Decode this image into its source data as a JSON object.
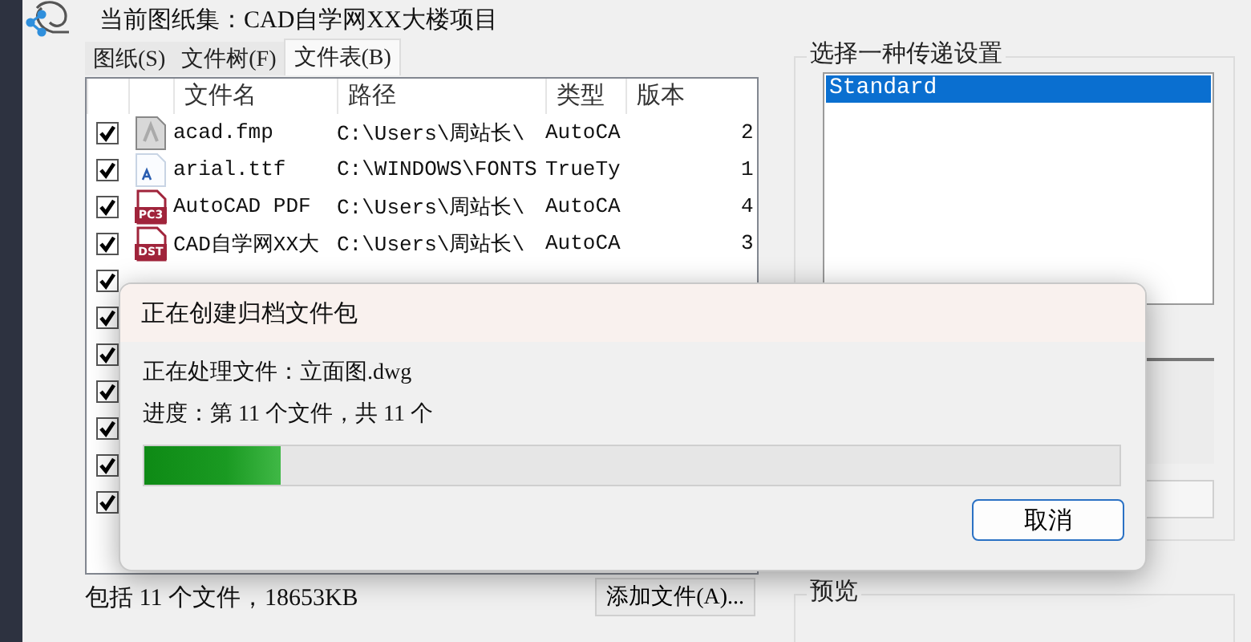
{
  "header": {
    "title": "当前图纸集：CAD自学网XX大楼项目"
  },
  "tabs": [
    {
      "label": "图纸(S)",
      "selected": false
    },
    {
      "label": "文件树(F)",
      "selected": false
    },
    {
      "label": "文件表(B)",
      "selected": true
    }
  ],
  "file_table": {
    "columns": [
      "文件名",
      "路径",
      "类型",
      "版本"
    ],
    "rows": [
      {
        "checked": true,
        "kind": "plain",
        "name": "acad.fmp",
        "path": "C:\\Users\\周站长\\",
        "type": "AutoCA",
        "column_5": "2"
      },
      {
        "checked": true,
        "kind": "font",
        "name": "arial.ttf",
        "path": "C:\\WINDOWS\\FONTS",
        "type": "TrueTy",
        "column_5": "1"
      },
      {
        "checked": true,
        "kind": "labeled",
        "icon_label": "PC3",
        "name": "AutoCAD PDF",
        "path": "C:\\Users\\周站长\\",
        "type": "AutoCA",
        "column_5": "4"
      },
      {
        "checked": true,
        "kind": "labeled",
        "icon_label": "DST",
        "name": "CAD自学网XX大",
        "path": "C:\\Users\\周站长\\",
        "type": "AutoCA",
        "column_5": "3"
      },
      {
        "checked": true
      },
      {
        "checked": true
      },
      {
        "checked": true
      },
      {
        "checked": true
      },
      {
        "checked": true
      },
      {
        "checked": true
      },
      {
        "checked": true
      }
    ]
  },
  "summary": "包括 11 个文件，18653KB",
  "add_button": "添加文件(A)...",
  "transmittal": {
    "title": "选择一种传递设置",
    "setups": [
      {
        "label": "Standard",
        "selected": true
      }
    ]
  },
  "preview": {
    "title": "预览"
  },
  "progress_dialog": {
    "title": "正在创建归档文件包",
    "current_file": "正在处理文件：立面图.dwg",
    "progress_text": "进度：第 11 个文件，共 11 个",
    "level": 0.14,
    "cancel": "取消"
  }
}
